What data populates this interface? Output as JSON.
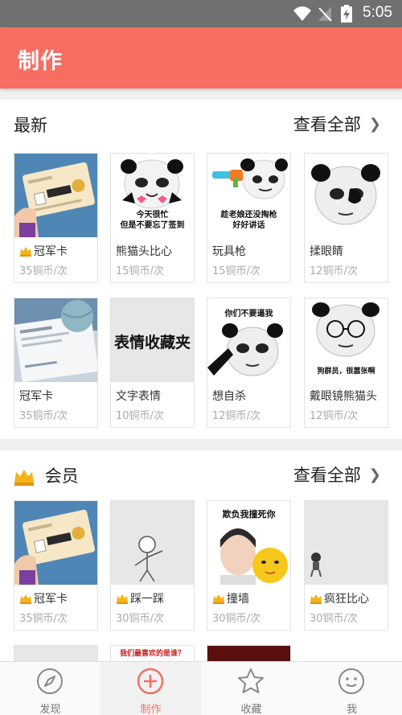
{
  "status_bar": {
    "time": "5:05"
  },
  "app_bar": {
    "title": "制作"
  },
  "latest": {
    "title": "最新",
    "more_label": "查看全部",
    "items": [
      {
        "name": "冠军卡",
        "price": "35铜币/次",
        "vip": true,
        "caption": ""
      },
      {
        "name": "熊猫头比心",
        "price": "15铜币/次",
        "vip": false,
        "caption": "今天很忙\n但是不要忘了签到"
      },
      {
        "name": "玩具枪",
        "price": "15铜币/次",
        "vip": false,
        "caption": "趁老娘还没掏枪\n好好讲话"
      },
      {
        "name": "揉眼睛",
        "price": "12铜币/次",
        "vip": false,
        "caption": ""
      },
      {
        "name": "冠军卡",
        "price": "35铜币/次",
        "vip": false,
        "caption": ""
      },
      {
        "name": "文字表情",
        "price": "10铜币/次",
        "vip": false,
        "caption": "表情收藏夹"
      },
      {
        "name": "想自杀",
        "price": "12铜币/次",
        "vip": false,
        "caption": "你们不要逼我"
      },
      {
        "name": "戴眼镜熊猫头",
        "price": "12铜币/次",
        "vip": false,
        "caption": "狗群员，很嚣张啊"
      }
    ]
  },
  "vip": {
    "title": "会员",
    "more_label": "查看全部",
    "items": [
      {
        "name": "冠军卡",
        "price": "35铜币/次",
        "vip": true,
        "caption": ""
      },
      {
        "name": "踩一踩",
        "price": "30铜币/次",
        "vip": true,
        "caption": ""
      },
      {
        "name": "撞墙",
        "price": "30铜币/次",
        "vip": true,
        "caption": "欺负我撞死你"
      },
      {
        "name": "疯狂比心",
        "price": "30铜币/次",
        "vip": true,
        "caption": ""
      }
    ],
    "partial_caption": "我们最喜欢的是谁？"
  },
  "bottom_nav": [
    {
      "label": "发现",
      "icon": "compass-icon",
      "active": false
    },
    {
      "label": "制作",
      "icon": "plus-circle-icon",
      "active": true
    },
    {
      "label": "收藏",
      "icon": "star-icon",
      "active": false
    },
    {
      "label": "我",
      "icon": "smiley-icon",
      "active": false
    }
  ],
  "colors": {
    "accent": "#f86d62",
    "status_bar": "#707070",
    "price_text": "#aaaaaa",
    "gold": "#f5b21a"
  }
}
